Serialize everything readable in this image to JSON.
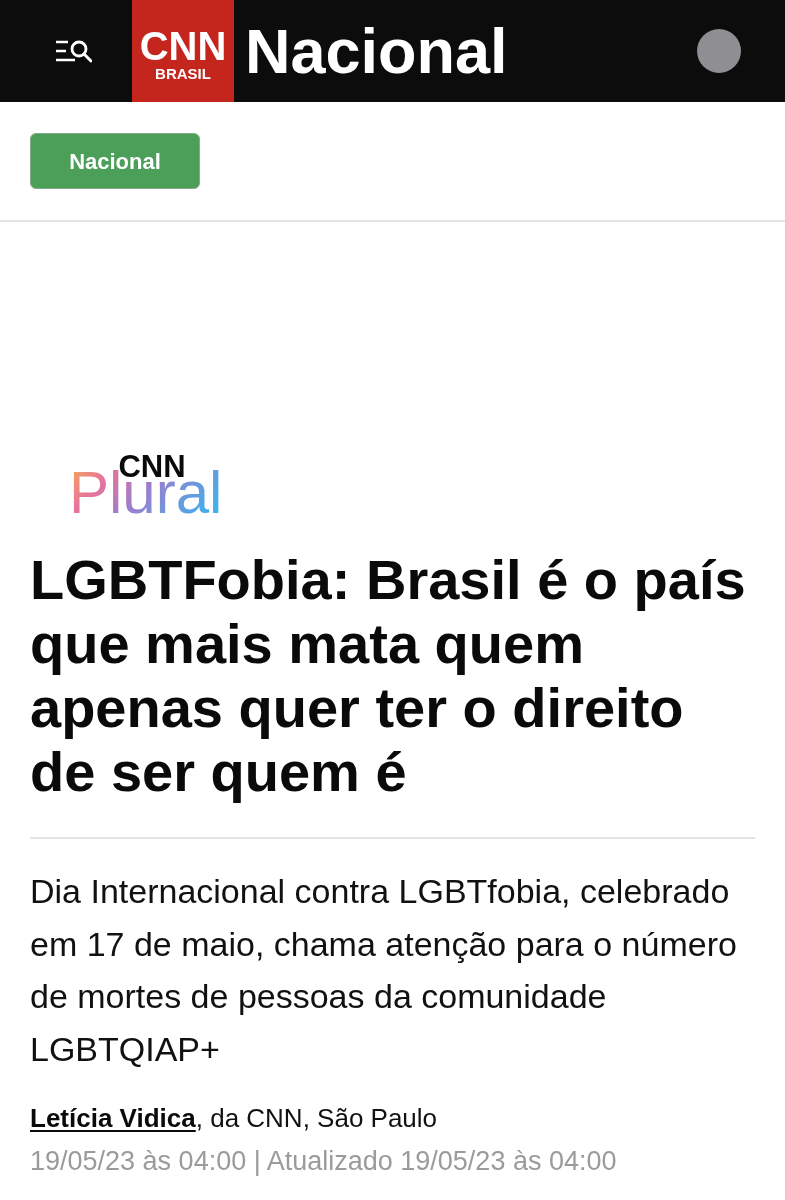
{
  "header": {
    "logo": {
      "line_1": "CNN",
      "line_2": "BRASIL"
    },
    "section_title": "Nacional"
  },
  "category_tag": {
    "label": "Nacional"
  },
  "article": {
    "brand_logo": {
      "line_1": "CNN",
      "line_2": "Plural"
    },
    "headline": "LGBTFobia: Brasil é o país que mais mata quem apenas quer ter o direito de ser quem é",
    "summary": "Dia Internacional contra LGBTfobia, celebrado em 17 de maio, chama atenção para o número de mortes de pessoas da comunidade LGBTQIAP+",
    "byline": {
      "author": "Letícia Vidica",
      "rest": ", da CNN, São Paulo"
    },
    "timestamp": "19/05/23 às 04:00 | Atualizado 19/05/23 às 04:00"
  }
}
